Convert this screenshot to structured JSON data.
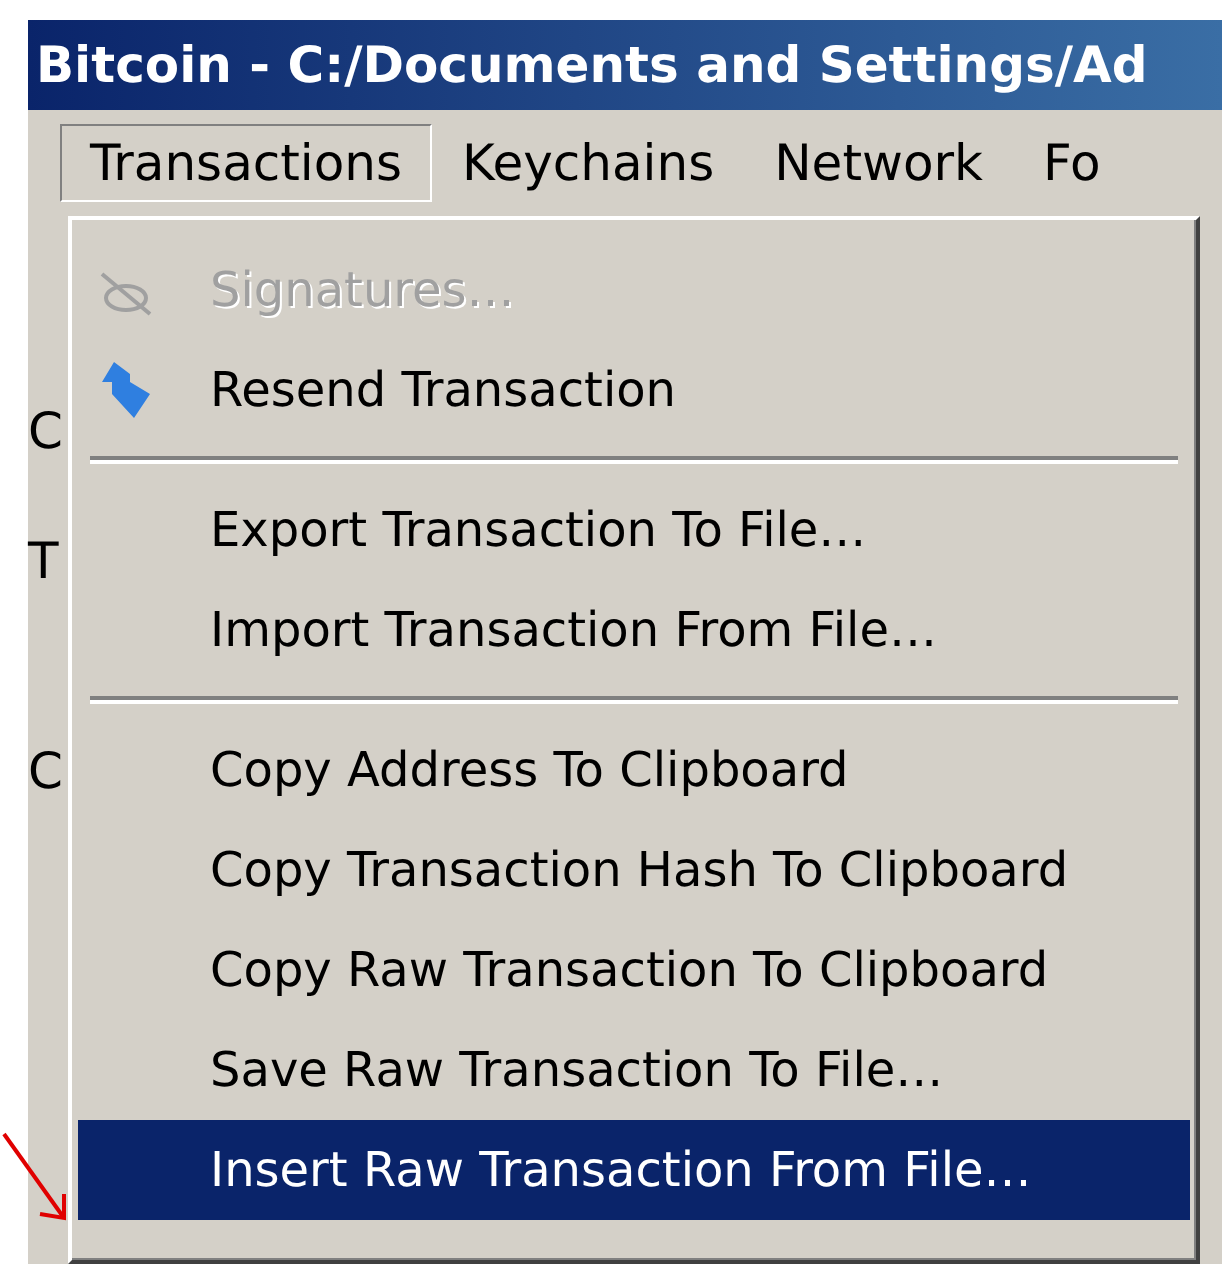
{
  "window": {
    "title": "Bitcoin - C:/Documents and Settings/Ad"
  },
  "menu_bar": [
    {
      "label": "Transactions",
      "selected": true
    },
    {
      "label": "Keychains",
      "selected": false
    },
    {
      "label": "Network",
      "selected": false
    },
    {
      "label": "Fo",
      "selected": false
    }
  ],
  "background_fragments": [
    "C",
    "T",
    "C"
  ],
  "menu": [
    {
      "kind": "item",
      "label": "Signatures…",
      "disabled": true,
      "selected": false
    },
    {
      "kind": "item",
      "label": "Resend Transaction",
      "disabled": false,
      "selected": false
    },
    {
      "kind": "separator"
    },
    {
      "kind": "item",
      "label": "Export Transaction To File…",
      "disabled": false,
      "selected": false
    },
    {
      "kind": "item",
      "label": "Import Transaction From File…",
      "disabled": false,
      "selected": false
    },
    {
      "kind": "separator"
    },
    {
      "kind": "item",
      "label": "Copy Address To Clipboard",
      "disabled": false,
      "selected": false
    },
    {
      "kind": "item",
      "label": "Copy Transaction Hash To Clipboard",
      "disabled": false,
      "selected": false
    },
    {
      "kind": "item",
      "label": "Copy Raw Transaction To Clipboard",
      "disabled": false,
      "selected": false
    },
    {
      "kind": "item",
      "label": "Save Raw Transaction To File…",
      "disabled": false,
      "selected": false
    },
    {
      "kind": "item",
      "label": "Insert Raw Transaction From File…",
      "disabled": false,
      "selected": true
    }
  ]
}
